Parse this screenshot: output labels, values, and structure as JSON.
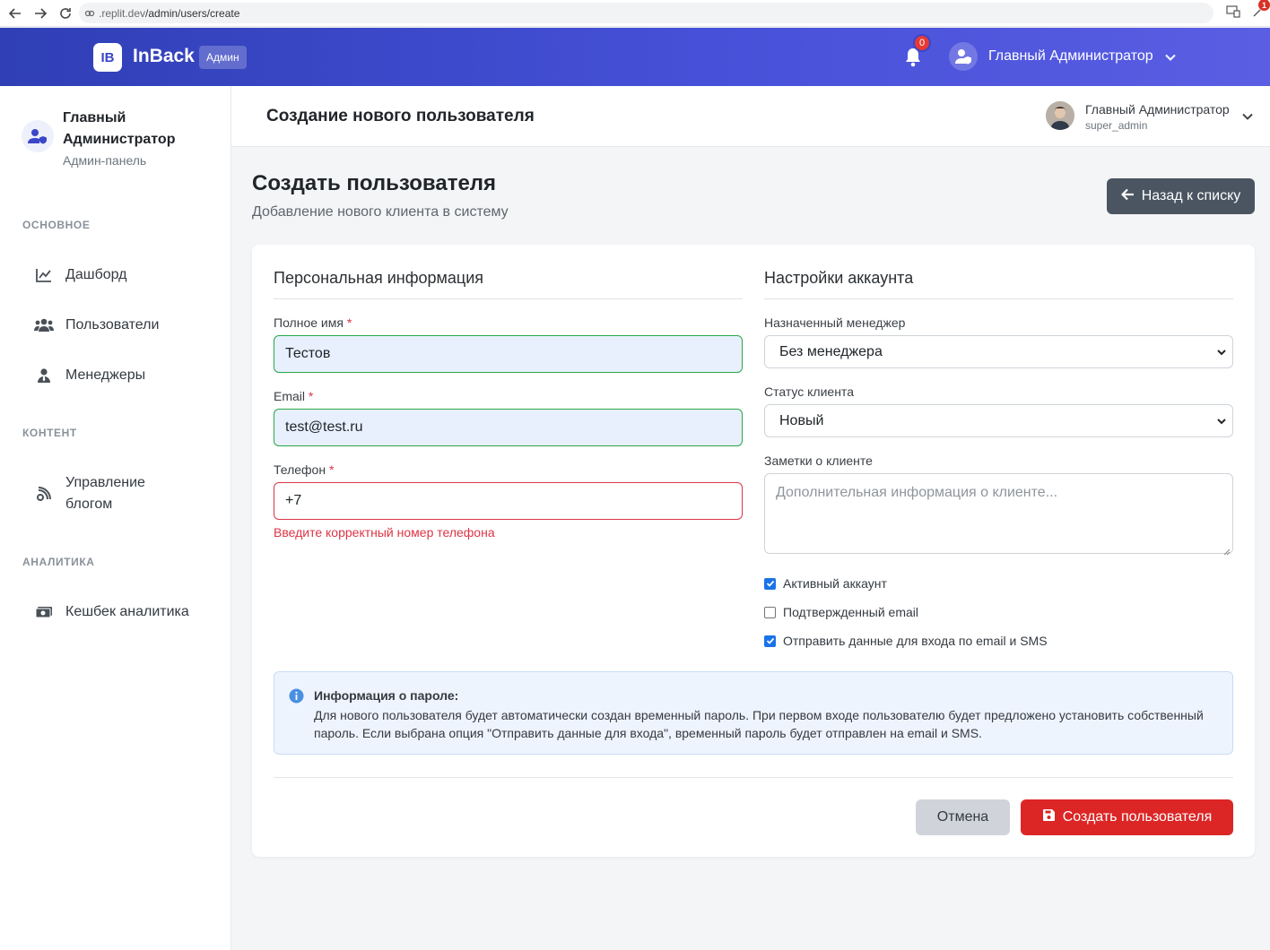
{
  "browser": {
    "url_muted": ".replit.dev",
    "url_path": "/admin/users/create",
    "extension_badge": "1"
  },
  "topbar": {
    "logo_text": "IB",
    "brand": "InBack",
    "brand_badge": "Админ",
    "notification_count": "0",
    "user_name": "Главный Администратор"
  },
  "sidebar": {
    "user_name": "Главный Администратор",
    "user_role": "Админ-панель",
    "sections": {
      "main": "ОСНОВНОЕ",
      "content": "КОНТЕНТ",
      "analytics": "АНАЛИТИКА"
    },
    "items": {
      "dashboard": "Дашборд",
      "users": "Пользователи",
      "managers": "Менеджеры",
      "blog": "Управление блогом",
      "cashback": "Кешбек аналитика"
    }
  },
  "page_header": {
    "title": "Создание нового пользователя",
    "user_name": "Главный Администратор",
    "user_login": "super_admin"
  },
  "content": {
    "title": "Создать пользователя",
    "subtitle": "Добавление нового клиента в систему",
    "back_button": "Назад к списку"
  },
  "form": {
    "personal_title": "Персональная информация",
    "account_title": "Настройки аккаунта",
    "full_name_label": "Полное имя",
    "full_name_value": "Тестов",
    "email_label": "Email",
    "email_value": "test@test.ru",
    "phone_label": "Телефон",
    "phone_value": "+7",
    "phone_error": "Введите корректный номер телефона",
    "required_mark": "*",
    "manager_label": "Назначенный менеджер",
    "manager_value": "Без менеджера",
    "status_label": "Статус клиента",
    "status_value": "Новый",
    "notes_label": "Заметки о клиенте",
    "notes_placeholder": "Дополнительная информация о клиенте...",
    "checkboxes": [
      {
        "label": "Активный аккаунт",
        "checked": true
      },
      {
        "label": "Подтвержденный email",
        "checked": false
      },
      {
        "label": "Отправить данные для входа по email и SMS",
        "checked": true
      }
    ],
    "info_title": "Информация о пароле:",
    "info_text": "Для нового пользователя будет автоматически создан временный пароль. При первом входе пользователю будет предложено установить собственный пароль. Если выбрана опция \"Отправить данные для входа\", временный пароль будет отправлен на email и SMS.",
    "cancel_button": "Отмена",
    "create_button": "Создать пользователя"
  },
  "colors": {
    "header_gradient_start": "#2f3fb5",
    "header_gradient_end": "#5a5ee3",
    "primary_red": "#dc2626",
    "valid_green": "#28a745",
    "error_red": "#dc3545",
    "checkbox_blue": "#1a73e8"
  }
}
